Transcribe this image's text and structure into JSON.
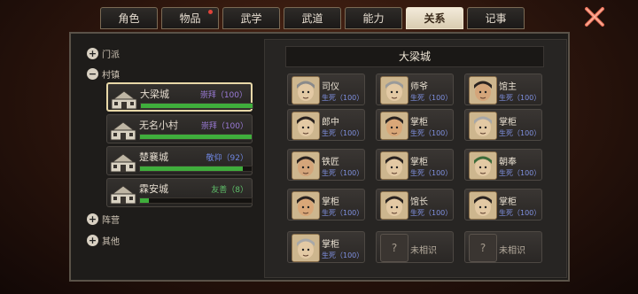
{
  "tabs": [
    {
      "label": "角色",
      "active": false,
      "badge": false
    },
    {
      "label": "物品",
      "active": false,
      "badge": true
    },
    {
      "label": "武学",
      "active": false,
      "badge": false
    },
    {
      "label": "武道",
      "active": false,
      "badge": false
    },
    {
      "label": "能力",
      "active": false,
      "badge": false
    },
    {
      "label": "关系",
      "active": true,
      "badge": false
    },
    {
      "label": "记事",
      "active": false,
      "badge": false
    }
  ],
  "tree": {
    "sect": {
      "icon": "+",
      "label": "门派"
    },
    "village": {
      "icon": "−",
      "label": "村镇"
    },
    "camp": {
      "icon": "+",
      "label": "阵营"
    },
    "other": {
      "icon": "+",
      "label": "其他"
    }
  },
  "towns": [
    {
      "name": "大梁城",
      "status": "崇拜（100）",
      "value": 100,
      "max": 100,
      "color": "#9b7bd8",
      "selected": true
    },
    {
      "name": "无名小村",
      "status": "崇拜（100）",
      "value": 100,
      "max": 100,
      "color": "#9b7bd8",
      "selected": false
    },
    {
      "name": "楚襄城",
      "status": "敬仰（92）",
      "value": 92,
      "max": 100,
      "color": "#6f86e0",
      "selected": false
    },
    {
      "name": "霖安城",
      "status": "友善（8）",
      "value": 8,
      "max": 100,
      "color": "#5fc06a",
      "selected": false
    }
  ],
  "right_title": "大梁城",
  "characters": [
    {
      "name": "司仪",
      "status": "生死（100）",
      "known": true,
      "hair": "#8a8a8a",
      "skin": "#e3c9a4"
    },
    {
      "name": "师爷",
      "status": "生死（100）",
      "known": true,
      "hair": "#9a9a9a",
      "skin": "#e3c9a4"
    },
    {
      "name": "馆主",
      "status": "生死（100）",
      "known": true,
      "hair": "#2a2320",
      "skin": "#d4a57a"
    },
    {
      "name": "郎中",
      "status": "生死（100）",
      "known": true,
      "hair": "#2a2320",
      "skin": "#e3c9a4"
    },
    {
      "name": "掌柜",
      "status": "生死（100）",
      "known": true,
      "hair": "#2a2320",
      "skin": "#d9a778"
    },
    {
      "name": "掌柜",
      "status": "生死（100）",
      "known": true,
      "hair": "#a8a8a8",
      "skin": "#e3c9a4"
    },
    {
      "name": "铁匠",
      "status": "生死（100）",
      "known": true,
      "hair": "#2a2320",
      "skin": "#d4a57a"
    },
    {
      "name": "掌柜",
      "status": "生死（100）",
      "known": true,
      "hair": "#2a2320",
      "skin": "#e3c9a4"
    },
    {
      "name": "朝奉",
      "status": "生死（100）",
      "known": true,
      "hair": "#3c6b3a",
      "skin": "#e3c9a4"
    },
    {
      "name": "掌柜",
      "status": "生死（100）",
      "known": true,
      "hair": "#2a2320",
      "skin": "#d9a778"
    },
    {
      "name": "馆长",
      "status": "生死（100）",
      "known": true,
      "hair": "#2a2320",
      "skin": "#e3c9a4"
    },
    {
      "name": "掌柜",
      "status": "生死（100）",
      "known": true,
      "hair": "#2a2320",
      "skin": "#e3c9a4"
    },
    {
      "name": "掌柜",
      "status": "生死（100）",
      "known": true,
      "hair": "#a8a8a8",
      "skin": "#e3c9a4"
    },
    {
      "name": "未相识",
      "status": "",
      "known": false
    },
    {
      "name": "未相识",
      "status": "",
      "known": false
    }
  ],
  "unknown_avatar_glyph": "?",
  "accent_bar_color": "#3fae3c"
}
